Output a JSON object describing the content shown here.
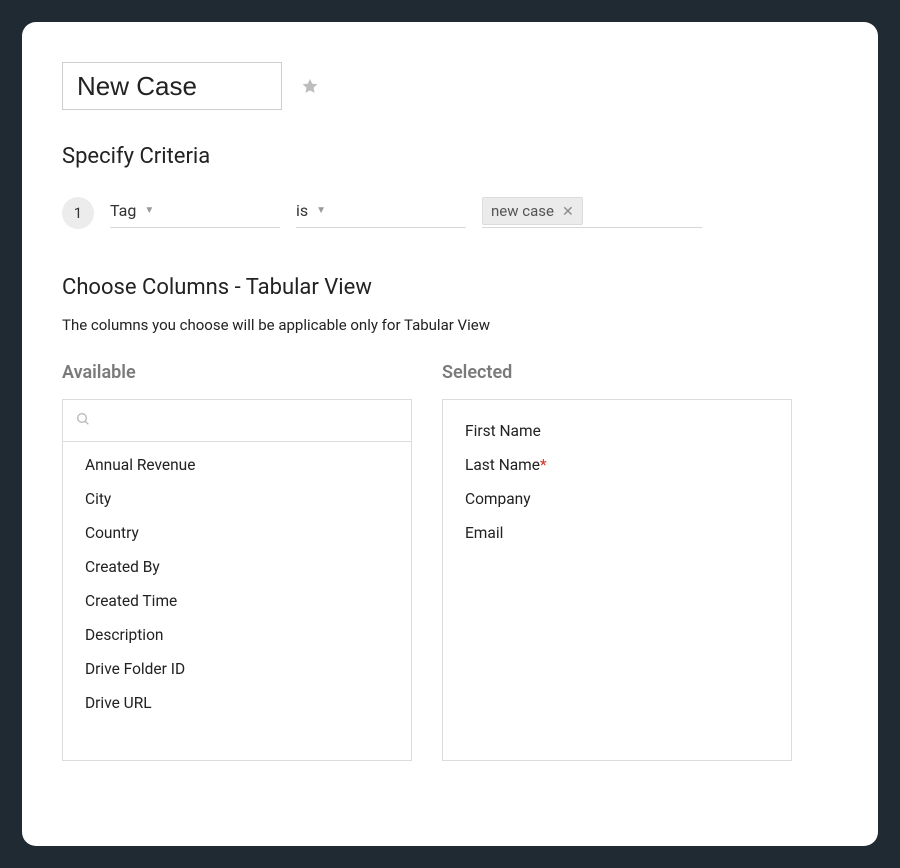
{
  "view_name": "New Case",
  "sections": {
    "criteria_title": "Specify Criteria",
    "columns_title": "Choose Columns - Tabular View",
    "columns_help": "The columns you choose will be applicable only for Tabular View",
    "available_label": "Available",
    "selected_label": "Selected"
  },
  "criteria": {
    "index": "1",
    "field": "Tag",
    "operator": "is",
    "value_chip": "new case"
  },
  "search_placeholder": "",
  "available_columns": [
    "Annual Revenue",
    "City",
    "Country",
    "Created By",
    "Created Time",
    "Description",
    "Drive Folder ID",
    "Drive URL"
  ],
  "selected_columns": [
    {
      "label": "First Name",
      "required": false
    },
    {
      "label": "Last Name",
      "required": true
    },
    {
      "label": "Company",
      "required": false
    },
    {
      "label": "Email",
      "required": false
    }
  ]
}
